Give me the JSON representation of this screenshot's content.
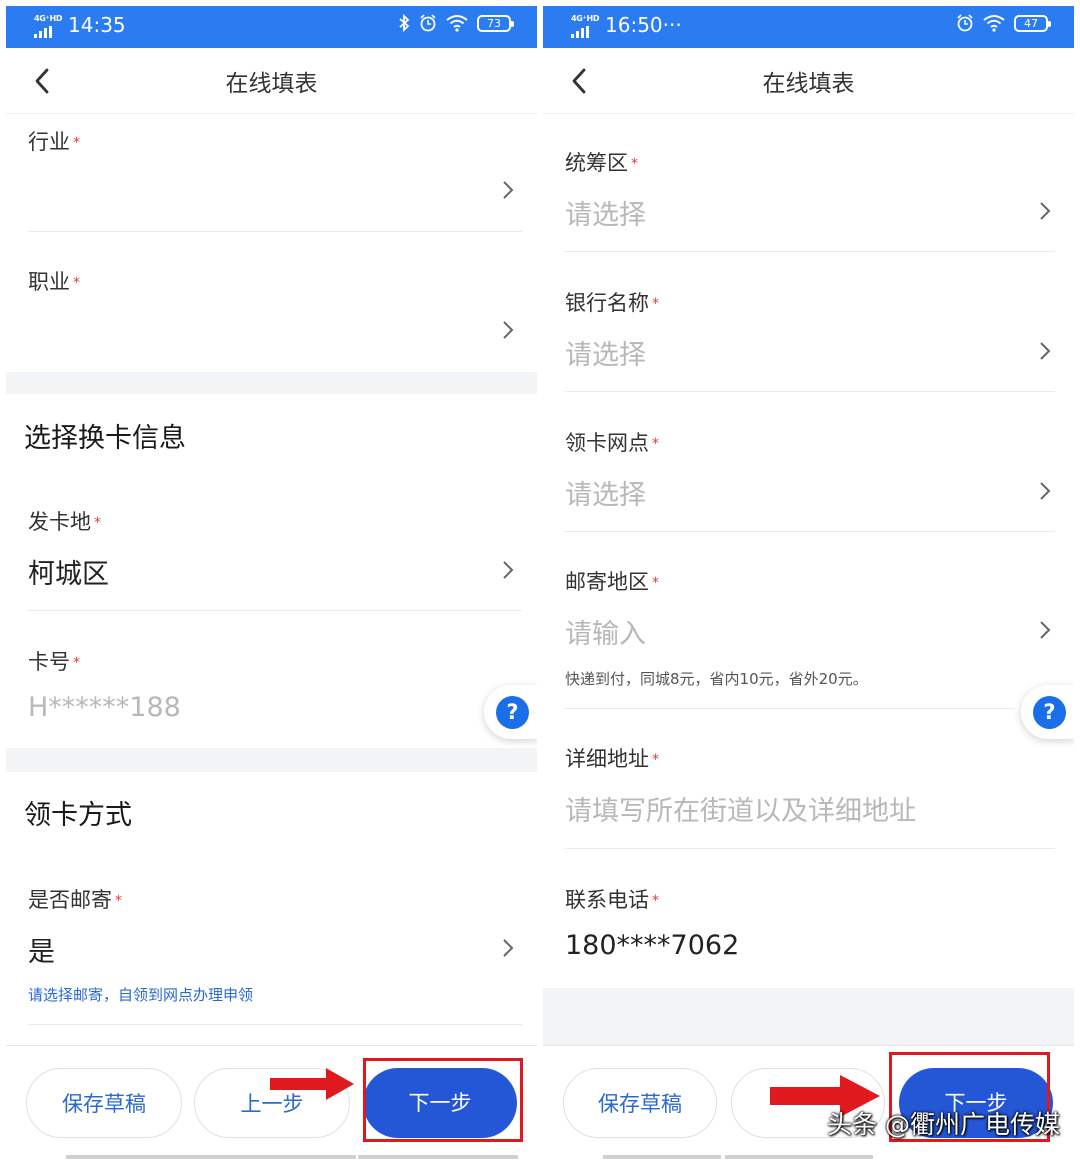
{
  "left": {
    "status": {
      "net": "4G⁺HD",
      "time": "14:35",
      "battery": "73"
    },
    "title": "在线填表",
    "fields": {
      "industry": {
        "label": "行业",
        "value": ""
      },
      "occupation": {
        "label": "职业",
        "value": ""
      },
      "issue_place": {
        "label": "发卡地",
        "value": "柯城区"
      },
      "card_no": {
        "label": "卡号",
        "value": "H******188"
      },
      "is_mail": {
        "label": "是否邮寄",
        "value": "是",
        "hint": "请选择邮寄，自领到网点办理申领"
      }
    },
    "sections": {
      "card_info": "选择换卡信息",
      "pickup": "领卡方式"
    },
    "buttons": {
      "save": "保存草稿",
      "prev": "上一步",
      "next": "下一步"
    },
    "help": "?"
  },
  "right": {
    "status": {
      "net": "4G⁺HD",
      "time": "16:50···",
      "battery": "47"
    },
    "title": "在线填表",
    "fields": {
      "pool_area": {
        "label": "统筹区",
        "placeholder": "请选择"
      },
      "bank_name": {
        "label": "银行名称",
        "placeholder": "请选择"
      },
      "pickup_point": {
        "label": "领卡网点",
        "placeholder": "请选择"
      },
      "mail_area": {
        "label": "邮寄地区",
        "placeholder": "请输入",
        "hint": "快递到付，同城8元，省内10元，省外20元。"
      },
      "address": {
        "label": "详细地址",
        "placeholder": "请填写所在街道以及详细地址"
      },
      "phone": {
        "label": "联系电话",
        "value": "180****7062"
      }
    },
    "buttons": {
      "save": "保存草稿",
      "next": "下一步"
    },
    "help": "?"
  },
  "required_mark": "*",
  "watermark": "头条 @衢州广电传媒",
  "colors": {
    "statusbar": "#2b7bf1",
    "primary": "#2457d6",
    "link": "#2a68d6",
    "required": "#e23b3b",
    "annotation": "#e0191f"
  }
}
